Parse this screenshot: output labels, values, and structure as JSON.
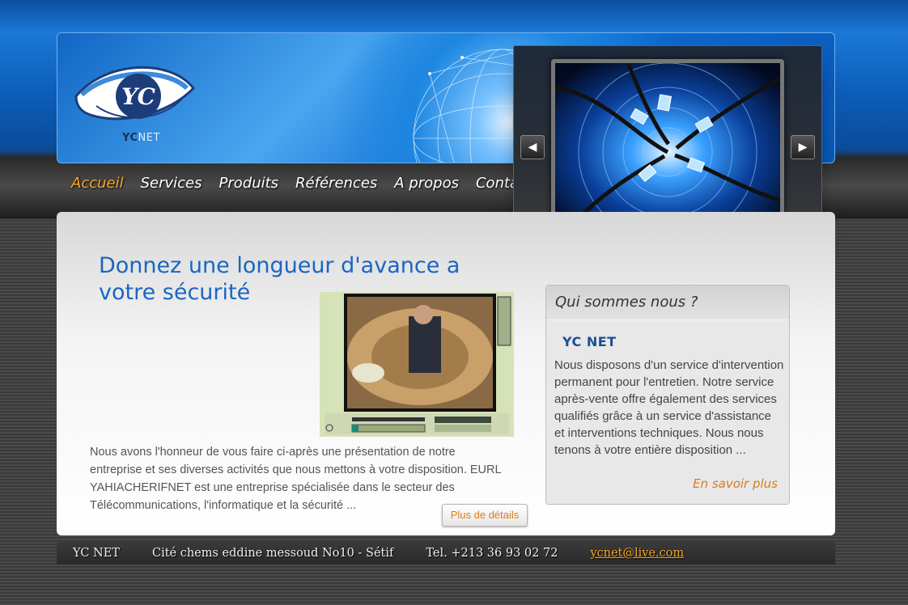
{
  "header": {
    "logo_mark": "YC",
    "logo_text_a": "YC",
    "logo_text_b": "NET"
  },
  "nav": {
    "items": [
      {
        "label": "Accueil",
        "active": true
      },
      {
        "label": "Services"
      },
      {
        "label": "Produits"
      },
      {
        "label": "Références"
      },
      {
        "label": "A propos"
      },
      {
        "label": "Contact"
      }
    ]
  },
  "slider": {
    "prev_icon": "triangle-left-icon",
    "next_icon": "triangle-right-icon",
    "prev_glyph": "◀",
    "next_glyph": "▶"
  },
  "main": {
    "headline": "Donnez une longueur d'avance a votre sécurité",
    "intro": "Nous avons l'honneur de vous faire ci-après une présentation de notre entreprise et ses diverses activités que nous mettons à votre disposition. EURL YAHIACHERIFNET est une entreprise spécialisée dans le secteur des Télécommunications, l'informatique et la sécurité ...",
    "more_button": "Plus de détails"
  },
  "about": {
    "title": "Qui sommes nous ?",
    "subtitle": "YC NET",
    "text": "Nous disposons d'un service d'intervention permanent pour l'entretien. Notre service après-vente offre également des services qualifiés grâce à un service d'assistance et interventions techniques. Nous nous tenons à votre entière disposition ...",
    "link": "En savoir plus"
  },
  "footer": {
    "company": "YC NET",
    "address": "Cité chems eddine messoud No10 - Sétif",
    "phone": "Tel. +213 36 93 02 72",
    "email": "ycnet@live.com"
  },
  "colors": {
    "accent": "#f5a623",
    "headline_blue": "#1a66c2",
    "link_orange": "#d97a1c"
  }
}
